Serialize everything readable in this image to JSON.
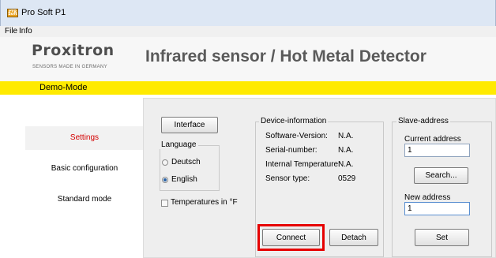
{
  "window": {
    "title": "Pro Soft P1",
    "icon": "app-icon",
    "icon_text": "Pro Soft"
  },
  "menu": {
    "items": [
      {
        "label": "File"
      },
      {
        "label": "Info"
      }
    ]
  },
  "header": {
    "logo": "Proxitron",
    "tagline": "SENSORS MADE IN GERMANY",
    "title": "Infrared sensor  / Hot Metal Detector"
  },
  "mode_bar": {
    "label": "Demo-Mode",
    "color": "#ffea00"
  },
  "nav": {
    "items": [
      {
        "label": "Settings",
        "active": true
      },
      {
        "label": "Basic configuration",
        "active": false
      },
      {
        "label": "Standard mode",
        "active": false
      }
    ],
    "active_color": "#d40000"
  },
  "settings": {
    "interface_button": "Interface",
    "language": {
      "title": "Language",
      "options": [
        {
          "label": "Deutsch",
          "selected": false
        },
        {
          "label": "English",
          "selected": true
        }
      ]
    },
    "temperatures_checkbox": {
      "label": "Temperatures in °F",
      "checked": false
    }
  },
  "device_info": {
    "title": "Device-information",
    "rows": [
      {
        "label": "Software-Version:",
        "value": "N.A."
      },
      {
        "label": "Serial-number:",
        "value": "N.A."
      },
      {
        "label": "Internal Temperature:",
        "value": "N.A."
      },
      {
        "label": "Sensor type:",
        "value": "0529"
      }
    ],
    "connect_button": "Connect",
    "detach_button": "Detach",
    "highlight_color": "#e60000"
  },
  "slave_address": {
    "title": "Slave-address",
    "current_label": "Current address",
    "current_value": "1",
    "search_button": "Search...",
    "new_label": "New address",
    "new_value": "1",
    "set_button": "Set"
  }
}
